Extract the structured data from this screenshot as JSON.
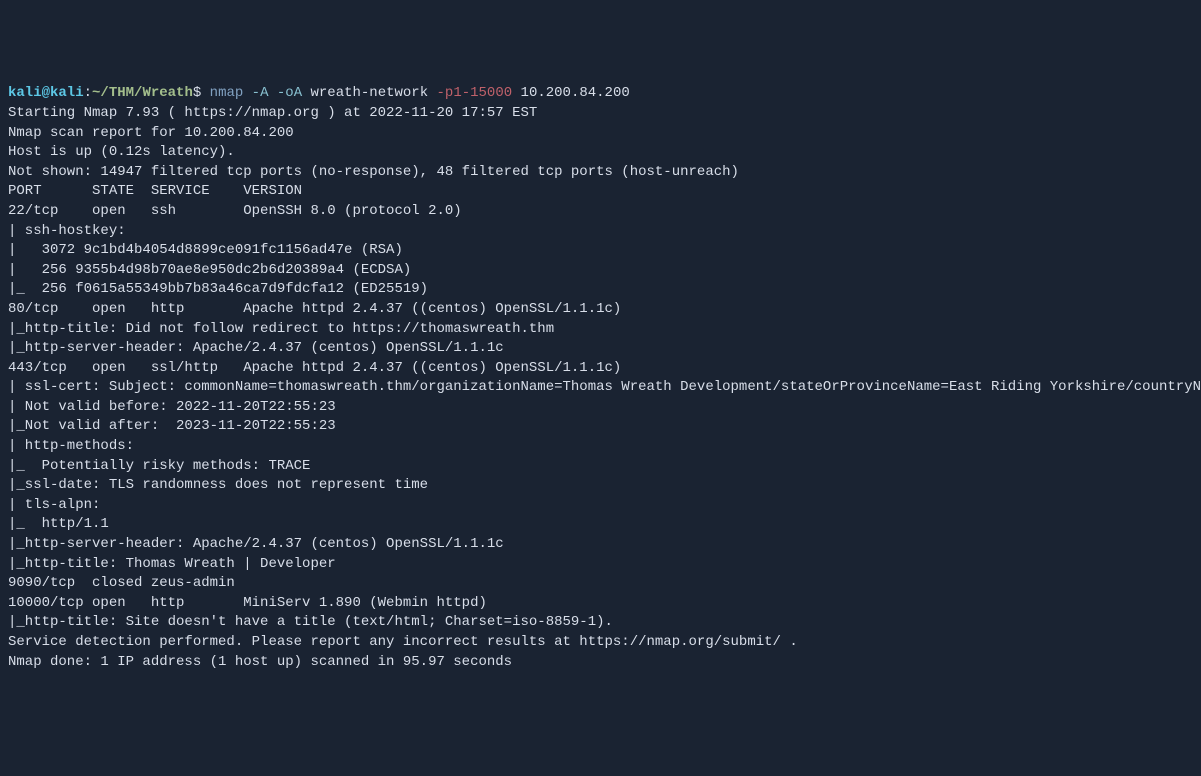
{
  "prompt": {
    "user": "kali@kali",
    "colon": ":",
    "path": "~/THM/Wreath",
    "dollar": "$ "
  },
  "command": {
    "cmd": "nmap",
    "flags1": " -A -oA",
    "args1": " wreath-network ",
    "flags2": "-p1-15000",
    "args2": " 10.200.84.200"
  },
  "output": [
    "Starting Nmap 7.93 ( https://nmap.org ) at 2022-11-20 17:57 EST",
    "Nmap scan report for 10.200.84.200",
    "Host is up (0.12s latency).",
    "Not shown: 14947 filtered tcp ports (no-response), 48 filtered tcp ports (host-unreach)",
    "PORT      STATE  SERVICE    VERSION",
    "22/tcp    open   ssh        OpenSSH 8.0 (protocol 2.0)",
    "| ssh-hostkey: ",
    "|   3072 9c1bd4b4054d8899ce091fc1156ad47e (RSA)",
    "|   256 9355b4d98b70ae8e950dc2b6d20389a4 (ECDSA)",
    "|_  256 f0615a55349bb7b83a46ca7d9fdcfa12 (ED25519)",
    "80/tcp    open   http       Apache httpd 2.4.37 ((centos) OpenSSL/1.1.1c)",
    "|_http-title: Did not follow redirect to https://thomaswreath.thm",
    "|_http-server-header: Apache/2.4.37 (centos) OpenSSL/1.1.1c",
    "443/tcp   open   ssl/http   Apache httpd 2.4.37 ((centos) OpenSSL/1.1.1c)",
    "| ssl-cert: Subject: commonName=thomaswreath.thm/organizationName=Thomas Wreath Development/stateOrProvinceName=East Riding Yorkshire/countryName=GB",
    "| Not valid before: 2022-11-20T22:55:23",
    "|_Not valid after:  2023-11-20T22:55:23",
    "| http-methods: ",
    "|_  Potentially risky methods: TRACE",
    "|_ssl-date: TLS randomness does not represent time",
    "| tls-alpn: ",
    "|_  http/1.1",
    "|_http-server-header: Apache/2.4.37 (centos) OpenSSL/1.1.1c",
    "|_http-title: Thomas Wreath | Developer",
    "9090/tcp  closed zeus-admin",
    "10000/tcp open   http       MiniServ 1.890 (Webmin httpd)",
    "|_http-title: Site doesn't have a title (text/html; Charset=iso-8859-1).",
    "",
    "Service detection performed. Please report any incorrect results at https://nmap.org/submit/ .",
    "Nmap done: 1 IP address (1 host up) scanned in 95.97 seconds"
  ]
}
